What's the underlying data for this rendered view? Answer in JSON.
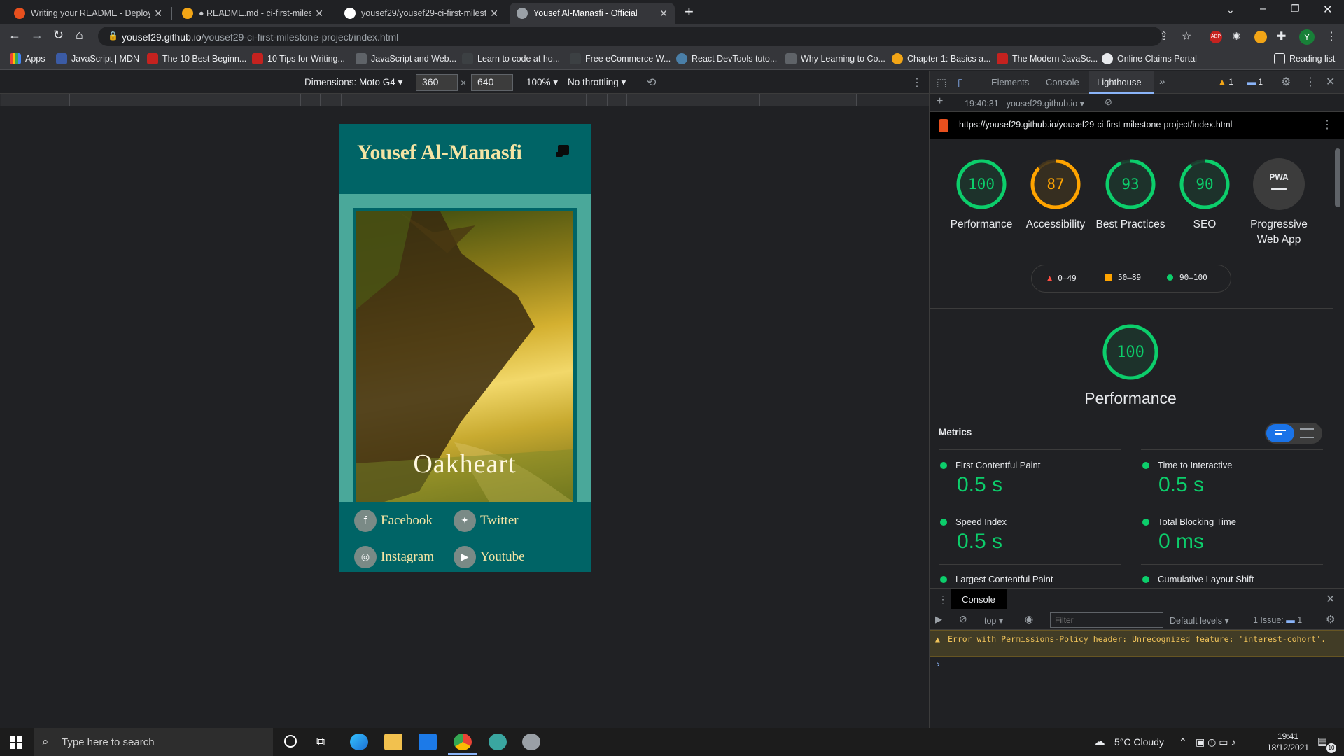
{
  "browser": {
    "tabs": [
      {
        "title": "Writing your README - Deploym",
        "active": false
      },
      {
        "title": "● README.md - ci-first-milestone",
        "active": false
      },
      {
        "title": "yousef29/yousef29-ci-first-milest",
        "active": false
      },
      {
        "title": "Yousef Al-Manasfi - Official",
        "active": true
      }
    ],
    "new_tab": "+",
    "url_host": "yousef29.github.io",
    "url_path": "/yousef29-ci-first-milestone-project/index.html",
    "profile_initial": "Y",
    "bookmarks": [
      "Apps",
      "JavaScript | MDN",
      "The 10 Best Beginn...",
      "10 Tips for Writing...",
      "JavaScript and Web...",
      "Learn to code at ho...",
      "Free eCommerce W...",
      "React DevTools tuto...",
      "Why Learning to Co...",
      "Chapter 1: Basics a...",
      "The Modern JavaSc...",
      "Online Claims Portal"
    ],
    "reading_list": "Reading list"
  },
  "device_toolbar": {
    "dimensions_label": "Dimensions: Moto G4",
    "width": "360",
    "times": "×",
    "height": "640",
    "zoom": "100%",
    "throttling": "No throttling"
  },
  "site": {
    "title": "Yousef Al-Manasfi",
    "hero_title": "Oakheart",
    "socials": [
      "Facebook",
      "Twitter",
      "Instagram",
      "Youtube"
    ]
  },
  "devtools": {
    "tabs": [
      "Elements",
      "Console",
      "Lighthouse"
    ],
    "active_tab": "Lighthouse",
    "warn_count": "1",
    "msg_count": "1",
    "report_label": "19:40:31 - yousef29.github.io",
    "report_url": "https://yousef29.github.io/yousef29-ci-first-milestone-project/index.html",
    "scores": [
      {
        "label": "Performance",
        "value": "100",
        "score": 100,
        "color": "#0cce6b"
      },
      {
        "label": "Accessibility",
        "value": "87",
        "score": 87,
        "color": "#ffa400"
      },
      {
        "label": "Best Practices",
        "value": "93",
        "score": 93,
        "color": "#0cce6b"
      },
      {
        "label": "SEO",
        "value": "90",
        "score": 90,
        "color": "#0cce6b"
      },
      {
        "label": "Progressive Web App",
        "value": "PWA",
        "score": 0,
        "color": "#9aa0a6"
      }
    ],
    "legend": [
      "0–49",
      "50–89",
      "90–100"
    ],
    "main_score": "100",
    "main_title": "Performance",
    "metrics_title": "Metrics",
    "metrics": [
      {
        "name": "First Contentful Paint",
        "value": "0.5 s"
      },
      {
        "name": "Time to Interactive",
        "value": "0.5 s"
      },
      {
        "name": "Speed Index",
        "value": "0.5 s"
      },
      {
        "name": "Total Blocking Time",
        "value": "0 ms"
      },
      {
        "name": "Largest Contentful Paint",
        "value": ""
      },
      {
        "name": "Cumulative Layout Shift",
        "value": ""
      }
    ]
  },
  "console": {
    "title": "Console",
    "context": "top",
    "filter_placeholder": "Filter",
    "levels": "Default levels",
    "issues": "1 Issue:",
    "issues_count": "1",
    "warning": "Error with Permissions-Policy header: Unrecognized feature: 'interest-cohort'.",
    "prompt": "›"
  },
  "taskbar": {
    "search_placeholder": "Type here to search",
    "weather": "5°C  Cloudy",
    "time": "19:41",
    "date": "18/12/2021",
    "notif": "10"
  },
  "colors": {
    "site_bg": "#006466",
    "site_title": "#f4e4a4",
    "good": "#0cce6b",
    "average": "#ffa400"
  }
}
